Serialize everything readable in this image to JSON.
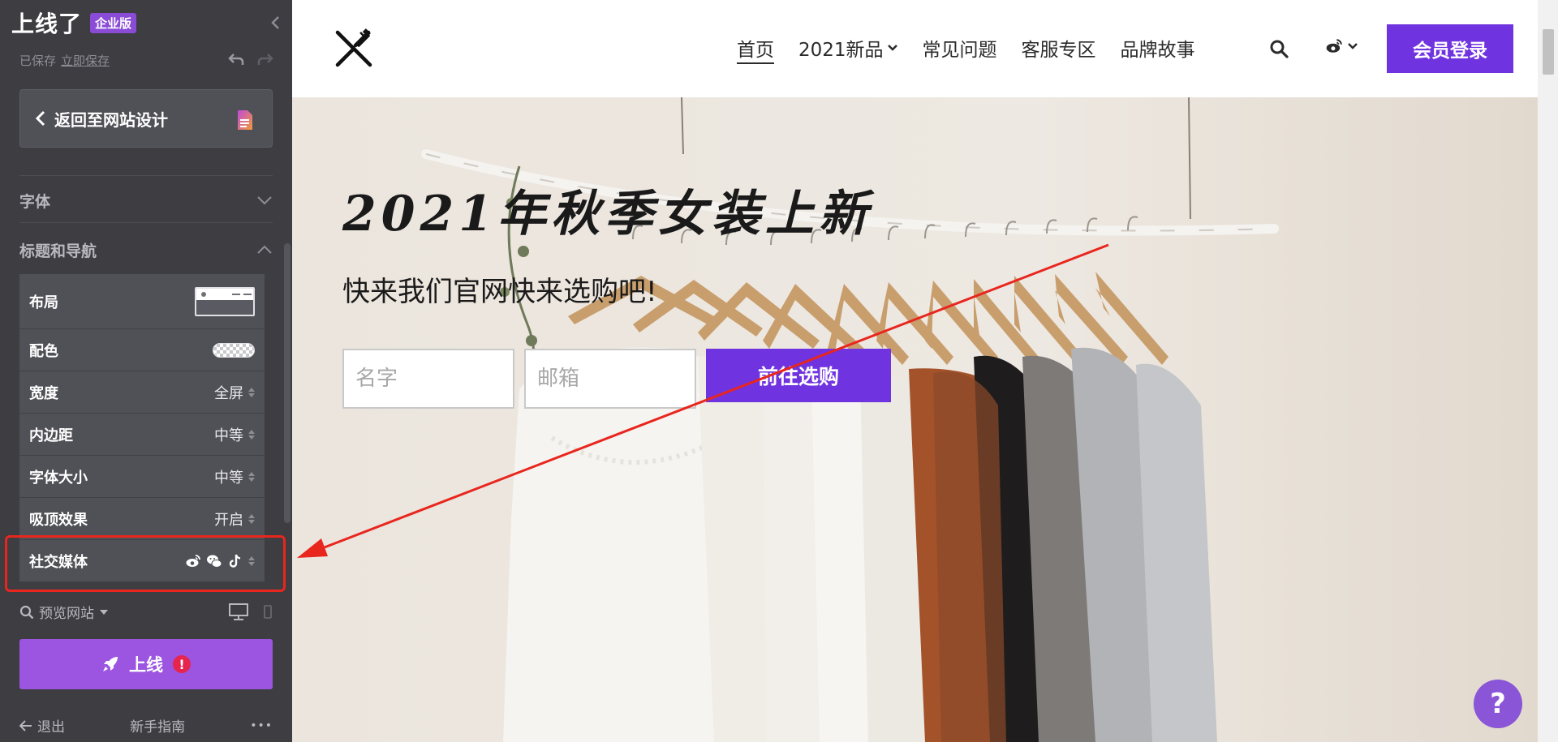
{
  "sidebar": {
    "brand": "上线了",
    "edition": "企业版",
    "save_status": "已保存",
    "save_now": "立即保存",
    "back_button": "返回至网站设计",
    "sections": {
      "font": "字体",
      "header_nav": "标题和导航"
    },
    "settings": [
      {
        "label": "布局",
        "value": ""
      },
      {
        "label": "配色",
        "value": ""
      },
      {
        "label": "宽度",
        "value": "全屏"
      },
      {
        "label": "内边距",
        "value": "中等"
      },
      {
        "label": "字体大小",
        "value": "中等"
      },
      {
        "label": "吸顶效果",
        "value": "开启"
      },
      {
        "label": "社交媒体",
        "value": ""
      }
    ],
    "preview": "预览网站",
    "launch": "上线",
    "launch_alert": "!",
    "exit": "退出",
    "guide": "新手指南",
    "more": "•••"
  },
  "nav": {
    "links": [
      "首页",
      "2021新品",
      "常见问题",
      "客服专区",
      "品牌故事"
    ],
    "login": "会员登录"
  },
  "hero": {
    "title": "2021年秋季女装上新",
    "subtitle": "快来我们官网快来选购吧!",
    "name_placeholder": "名字",
    "email_placeholder": "邮箱",
    "submit": "前往选购"
  },
  "help": "?",
  "colors": {
    "sidebar_bg": "#3d3d42",
    "accent": "#7033e0",
    "launch": "#9b55e0",
    "highlight": "#e8261e"
  }
}
